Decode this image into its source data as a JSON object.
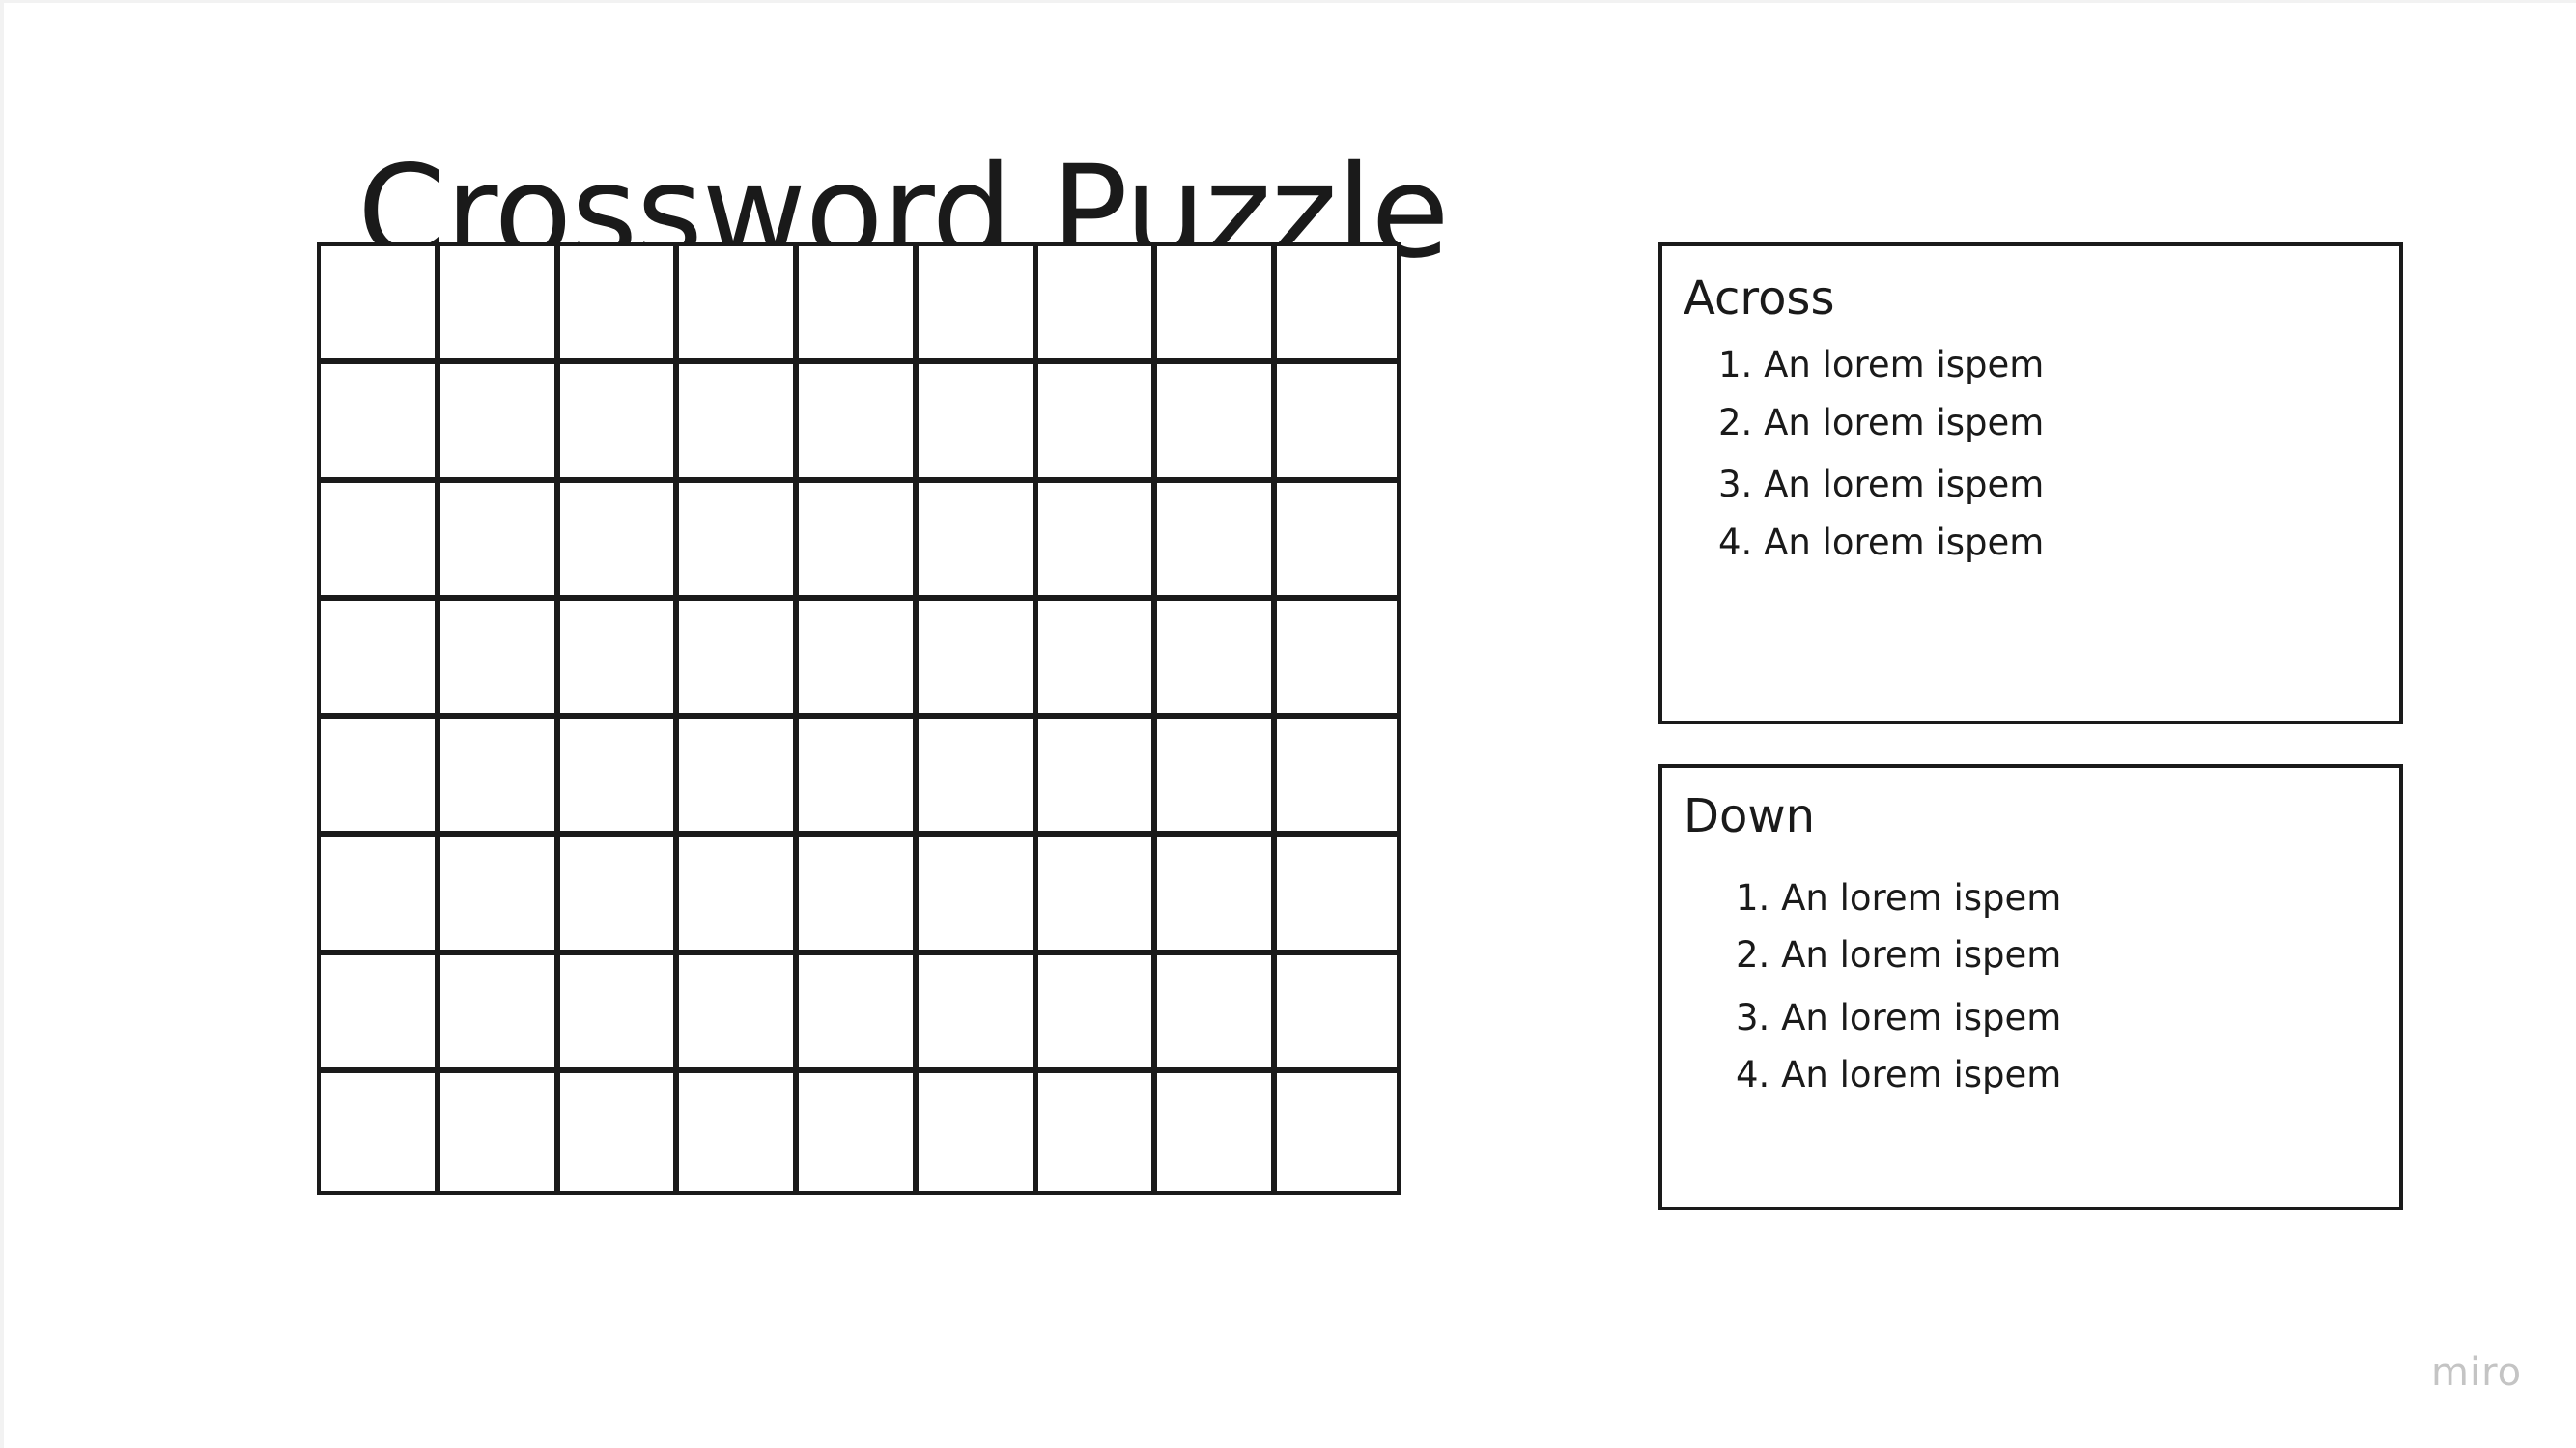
{
  "page": {
    "title": "Crossword Puzzle"
  },
  "grid": {
    "columns": 9,
    "rows": 8
  },
  "across": {
    "heading": "Across",
    "clues": [
      "1. An lorem ispem",
      "2. An lorem ispem",
      "3. An lorem ispem",
      "4. An lorem ispem"
    ]
  },
  "down": {
    "heading": "Down",
    "clues": [
      "1. An lorem ispem",
      "2. An lorem ispem",
      "3. An lorem ispem",
      "4. An lorem ispem"
    ]
  },
  "watermark": {
    "text": "miro",
    "color": "#c4c4c4"
  },
  "colors": {
    "ink": "#1a1a1a",
    "background": "#ffffff"
  }
}
